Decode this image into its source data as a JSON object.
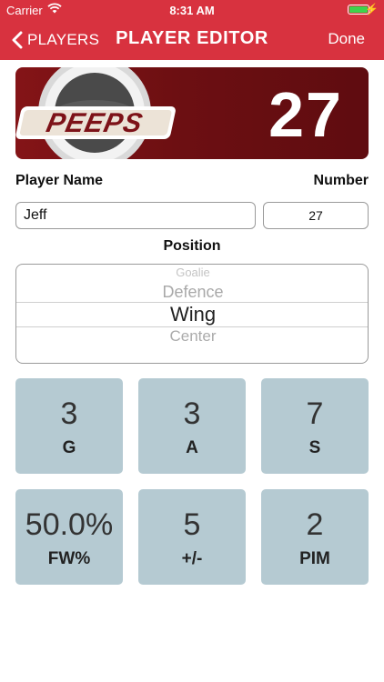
{
  "status_bar": {
    "carrier": "Carrier",
    "time": "8:31 AM",
    "battery_color": "#3fd34c"
  },
  "nav": {
    "back_label": "PLAYERS",
    "title": "PLAYER EDITOR",
    "done_label": "Done",
    "bar_color": "#d8323f"
  },
  "banner": {
    "team_logo_text": "PEEPS",
    "number": "27",
    "background_color": "#6d0f12"
  },
  "form": {
    "player_name_label": "Player Name",
    "player_name_value": "Jeff",
    "number_label": "Number",
    "number_value": "27",
    "position_label": "Position"
  },
  "position_picker": {
    "options": [
      "Goalie",
      "Defence",
      "Wing",
      "Center"
    ],
    "selected": "Wing"
  },
  "stats": [
    {
      "value": "3",
      "label": "G"
    },
    {
      "value": "3",
      "label": "A"
    },
    {
      "value": "7",
      "label": "S"
    },
    {
      "value": "50.0%",
      "label": "FW%"
    },
    {
      "value": "5",
      "label": "+/-"
    },
    {
      "value": "2",
      "label": "PIM"
    }
  ],
  "colors": {
    "tile_background": "#b5cad2"
  }
}
